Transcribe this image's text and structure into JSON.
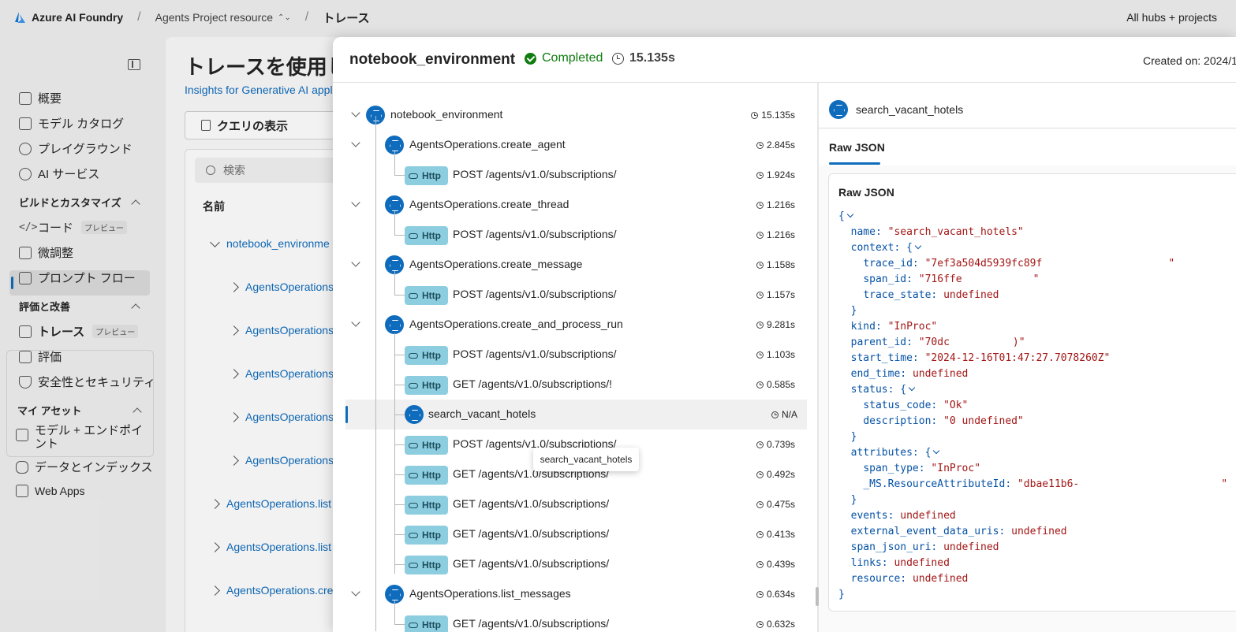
{
  "topbar": {
    "brand": "Azure AI Foundry",
    "project": "Agents Project resource",
    "page": "トレース",
    "right": "All hubs + projects"
  },
  "sidebar": {
    "items_top": [
      {
        "label": "概要",
        "icon": "home-icon"
      },
      {
        "label": "モデル カタログ",
        "icon": "cube-icon"
      },
      {
        "label": "プレイグラウンド",
        "icon": "chat-icon"
      },
      {
        "label": "AI サービス",
        "icon": "ai-services-icon"
      }
    ],
    "section_build": "ビルドとカスタマイズ",
    "items_build": [
      {
        "label": "コード",
        "badge": "プレビュー",
        "icon": "code-icon"
      },
      {
        "label": "微調整",
        "icon": "flask-icon"
      },
      {
        "label": "プロンプト フロー",
        "icon": "flow-icon"
      }
    ],
    "section_eval": "評価と改善",
    "items_eval": [
      {
        "label": "トレース",
        "badge": "プレビュー",
        "icon": "trace-icon"
      },
      {
        "label": "評価",
        "icon": "evaluation-icon"
      },
      {
        "label": "安全性とセキュリティ",
        "icon": "shield-icon"
      }
    ],
    "section_assets": "マイ アセット",
    "items_assets": [
      {
        "label": "モデル + エンドポイント",
        "icon": "cube-icon"
      },
      {
        "label": "データとインデックス",
        "icon": "database-icon"
      },
      {
        "label": "Web Apps",
        "icon": "apps-icon"
      }
    ]
  },
  "main": {
    "title": "トレースを使用し",
    "subtitle": "Insights for Generative AI appl",
    "query_tab": "クエリの表示",
    "search_placeholder": "検索",
    "col_name": "名前",
    "rows": [
      "notebook_environme",
      "AgentsOperations",
      "AgentsOperations",
      "AgentsOperations",
      "AgentsOperations",
      "AgentsOperations",
      "AgentsOperations.list",
      "AgentsOperations.list",
      "AgentsOperations.cre"
    ]
  },
  "panel": {
    "title": "notebook_environment",
    "status": "Completed",
    "duration": "15.135s",
    "created": "Created on: 2024/1",
    "tree": [
      {
        "label": "notebook_environment",
        "time": "15.135s",
        "kind": "root"
      },
      {
        "label": "AgentsOperations.create_agent",
        "time": "2.845s",
        "kind": "op"
      },
      {
        "label": "POST /agents/v1.0/subscriptions/",
        "time": "1.924s",
        "kind": "http"
      },
      {
        "label": "AgentsOperations.create_thread",
        "time": "1.216s",
        "kind": "op"
      },
      {
        "label": "POST /agents/v1.0/subscriptions/",
        "time": "1.216s",
        "kind": "http"
      },
      {
        "label": "AgentsOperations.create_message",
        "time": "1.158s",
        "kind": "op"
      },
      {
        "label": "POST /agents/v1.0/subscriptions/",
        "time": "1.157s",
        "kind": "http"
      },
      {
        "label": "AgentsOperations.create_and_process_run",
        "time": "9.281s",
        "kind": "op"
      },
      {
        "label": "POST /agents/v1.0/subscriptions/",
        "time": "1.103s",
        "kind": "http2"
      },
      {
        "label": "GET /agents/v1.0/subscriptions/!",
        "time": "0.585s",
        "kind": "http2"
      },
      {
        "label": "search_vacant_hotels",
        "time": "N/A",
        "kind": "tool"
      },
      {
        "label": "POST /agents/v1.0/subscriptions/",
        "time": "0.739s",
        "kind": "http2"
      },
      {
        "label": "GET /agents/v1.0/subscriptions/",
        "time": "0.492s",
        "kind": "http2"
      },
      {
        "label": "GET /agents/v1.0/subscriptions/",
        "time": "0.475s",
        "kind": "http2"
      },
      {
        "label": "GET /agents/v1.0/subscriptions/",
        "time": "0.413s",
        "kind": "http2"
      },
      {
        "label": "GET /agents/v1.0/subscriptions/",
        "time": "0.439s",
        "kind": "http2"
      },
      {
        "label": "AgentsOperations.list_messages",
        "time": "0.634s",
        "kind": "op"
      },
      {
        "label": "GET /agents/v1.0/subscriptions/",
        "time": "0.632s",
        "kind": "http"
      }
    ],
    "http_badge": "Http",
    "tooltip": "search_vacant_hotels"
  },
  "detail": {
    "title": "search_vacant_hotels",
    "tab": "Raw JSON",
    "card_title": "Raw JSON",
    "json": {
      "name": "\"search_vacant_hotels\"",
      "trace_id": "\"7ef3a504d5939fc89f",
      "trace_id_end": "\"",
      "span_id": "\"716ffe",
      "span_id_end": "\"",
      "trace_state": "undefined",
      "kind": "\"InProc\"",
      "parent_id": "\"70dc",
      "parent_id_end": ")\"",
      "start_time": "\"2024-12-16T01:47:27.7078260Z\"",
      "end_time": "undefined",
      "status_code": "\"Ok\"",
      "description": "\"0 undefined\"",
      "span_type": "\"InProc\"",
      "resource_attr": "\"dbae11b6-",
      "resource_attr_end": "\"",
      "events": "undefined",
      "external_event_data_uris": "undefined",
      "span_json_uri": "undefined",
      "links": "undefined",
      "resource": "undefined"
    }
  },
  "colors": {
    "accent": "#0f6cbd",
    "success": "#107c10",
    "http_badge": "#8dcde0"
  }
}
